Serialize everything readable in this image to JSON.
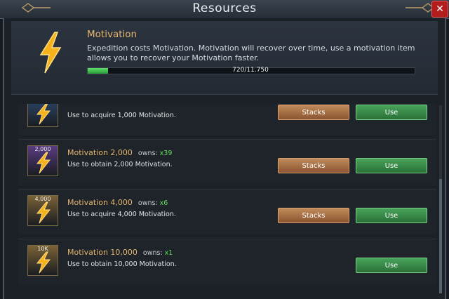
{
  "window": {
    "title": "Resources",
    "close_label": "✕"
  },
  "header": {
    "title": "Motivation",
    "description": "Expedition costs Motivation. Motivation will recover over time, use a motivation item allows you to recover your Motivation faster.",
    "progress_text": "720/11.750",
    "progress_fraction": 0.0613
  },
  "items": [
    {
      "name": "",
      "owns_label": "",
      "count": "",
      "desc": "Use to acquire 1,000 Motivation.",
      "qty_label": "",
      "stacks_label": "Stacks",
      "use_label": "Use",
      "icon_color": "#2c4a6e"
    },
    {
      "name": "Motivation 2,000",
      "owns_label": "owns:",
      "count": "x39",
      "desc": "Use to obtain 2,000 Motivation.",
      "qty_label": "2,000",
      "stacks_label": "Stacks",
      "use_label": "Use",
      "icon_color": "#5a3b82"
    },
    {
      "name": "Motivation 4,000",
      "owns_label": "owns:",
      "count": "x6",
      "desc": "Use to acquire 4,000 Motivation.",
      "qty_label": "4,000",
      "stacks_label": "Stacks",
      "use_label": "Use",
      "icon_color": "#7a6236"
    },
    {
      "name": "Motivation 10,000",
      "owns_label": "owns:",
      "count": "x1",
      "desc": "Use to obtain 10,000 Motivation.",
      "qty_label": "10K",
      "stacks_label": "",
      "use_label": "Use",
      "icon_color": "#7a6236"
    }
  ]
}
